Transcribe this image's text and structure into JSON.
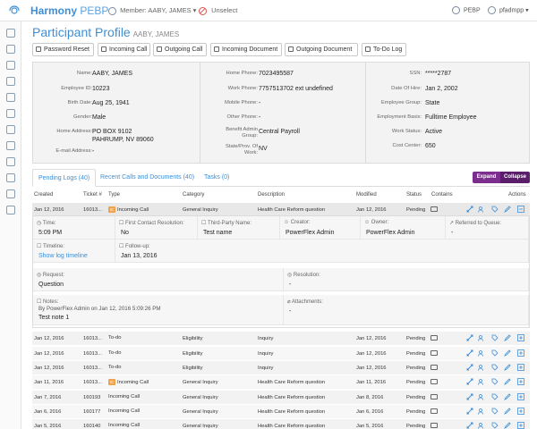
{
  "app": {
    "brand": "Harmony",
    "brand_sub": "PEBP",
    "member_label": "Member: AABY, JAMES",
    "unselect_label": "Unselect",
    "right_item1": "PEBP",
    "right_item2": "pfadmpp"
  },
  "page": {
    "title": "Participant Profile",
    "name": "AABY, JAMES"
  },
  "actions": [
    "Password Reset",
    "Incoming Call",
    "Outgoing Call",
    "Incoming Document",
    "Outgoing Document",
    "To-Do Log"
  ],
  "profile": {
    "left": [
      {
        "label": "Name:",
        "value": "AABY, JAMES"
      },
      {
        "label": "Employee ID:",
        "value": "10223"
      },
      {
        "label": "Birth Date:",
        "value": "Aug 25, 1941"
      },
      {
        "label": "Gender:",
        "value": "Male"
      },
      {
        "label": "Home Address:",
        "value": "PO BOX 9102",
        "value2": "PAHRUMP, NV 89060"
      },
      {
        "label": "E-mail Address:",
        "value": "-"
      }
    ],
    "middle": [
      {
        "label": "Home Phone:",
        "value": "7023495587"
      },
      {
        "label": "Work Phone:",
        "value": "7757513702 ext undefined"
      },
      {
        "label": "Mobile Phone:",
        "value": "-"
      },
      {
        "label": "Other Phone:",
        "value": "-"
      },
      {
        "label": "Benefit Admin Group:",
        "value": "Central Payroll"
      },
      {
        "label": "State/Prov. Of Work:",
        "value": "NV"
      }
    ],
    "right": [
      {
        "label": "SSN:",
        "value": "*****2787"
      },
      {
        "label": "Date Of Hire:",
        "value": "Jan 2, 2002"
      },
      {
        "label": "Employee Group:",
        "value": "State"
      },
      {
        "label": "Employment Basis:",
        "value": "Fulltime Employee"
      },
      {
        "label": "Work Status:",
        "value": "Active"
      },
      {
        "label": "Cost Center:",
        "value": "650"
      }
    ]
  },
  "tabs": [
    "Pending Logs (40)",
    "Recent Calls and Documents (40)",
    "Tasks (0)"
  ],
  "buttons": {
    "expand": "Expand",
    "collapse": "Collapse"
  },
  "columns": [
    "Created",
    "Ticket #",
    "Type",
    "Category",
    "Description",
    "Modified",
    "Status",
    "Contains",
    "Actions"
  ],
  "selected_row": {
    "created": "Jan 12, 2016",
    "ticket": "16013...",
    "badge": "IC",
    "type": "Incoming Call",
    "category": "General Inquiry",
    "description": "Health Care Reform question",
    "modified": "Jan 12, 2016",
    "status": "Pending"
  },
  "detail": {
    "time_label": "Time:",
    "time": "5:09 PM",
    "first_contact_label": "First Contact Resolution:",
    "first_contact": "No",
    "third_party_label": "Third-Party Name:",
    "third_party": "Test name",
    "creator_label": "Creator:",
    "creator": "PowerFlex Admin",
    "owner_label": "Owner:",
    "owner": "PowerFlex Admin",
    "referred_label": "Referred to Queue:",
    "referred": "-",
    "timeline_label": "Timeline:",
    "timeline_link": "Show log timeline",
    "followup_label": "Follow-up:",
    "followup": "Jan 13, 2016",
    "request_label": "Request:",
    "request": "Question",
    "resolution_label": "Resolution:",
    "resolution": "-",
    "notes_label": "Notes:",
    "notes_by": "By PowerFlex Admin on Jan 12, 2016 5:09:26 PM",
    "notes_text": "Test note 1",
    "attachments_label": "Attachments:",
    "attachments": "-"
  },
  "rows": [
    {
      "created": "Jan 12, 2016",
      "ticket": "16013...",
      "badge": "",
      "type": "To-do",
      "category": "Eligibility",
      "description": "Inquiry",
      "modified": "Jan 12, 2016",
      "status": "Pending"
    },
    {
      "created": "Jan 12, 2016",
      "ticket": "16013...",
      "badge": "",
      "type": "To-do",
      "category": "Eligibility",
      "description": "Inquiry",
      "modified": "Jan 12, 2016",
      "status": "Pending"
    },
    {
      "created": "Jan 12, 2016",
      "ticket": "16013...",
      "badge": "",
      "type": "To-do",
      "category": "Eligibility",
      "description": "Inquiry",
      "modified": "Jan 12, 2016",
      "status": "Pending"
    },
    {
      "created": "Jan 11, 2016",
      "ticket": "16013...",
      "badge": "IC",
      "type": "Incoming Call",
      "category": "General Inquiry",
      "description": "Health Care Reform question",
      "modified": "Jan 11, 2016",
      "status": "Pending"
    },
    {
      "created": "Jan 7, 2016",
      "ticket": "160193",
      "badge": "",
      "type": "Incoming Call",
      "category": "General Inquiry",
      "description": "Health Care Reform question",
      "modified": "Jan 8, 2016",
      "status": "Pending"
    },
    {
      "created": "Jan 6, 2016",
      "ticket": "160177",
      "badge": "",
      "type": "Incoming Call",
      "category": "General Inquiry",
      "description": "Health Care Reform question",
      "modified": "Jan 6, 2016",
      "status": "Pending"
    },
    {
      "created": "Jan 5, 2016",
      "ticket": "160140",
      "badge": "",
      "type": "Incoming Call",
      "category": "General Inquiry",
      "description": "Health Care Reform question",
      "modified": "Jan 5, 2016",
      "status": "Pending"
    }
  ]
}
